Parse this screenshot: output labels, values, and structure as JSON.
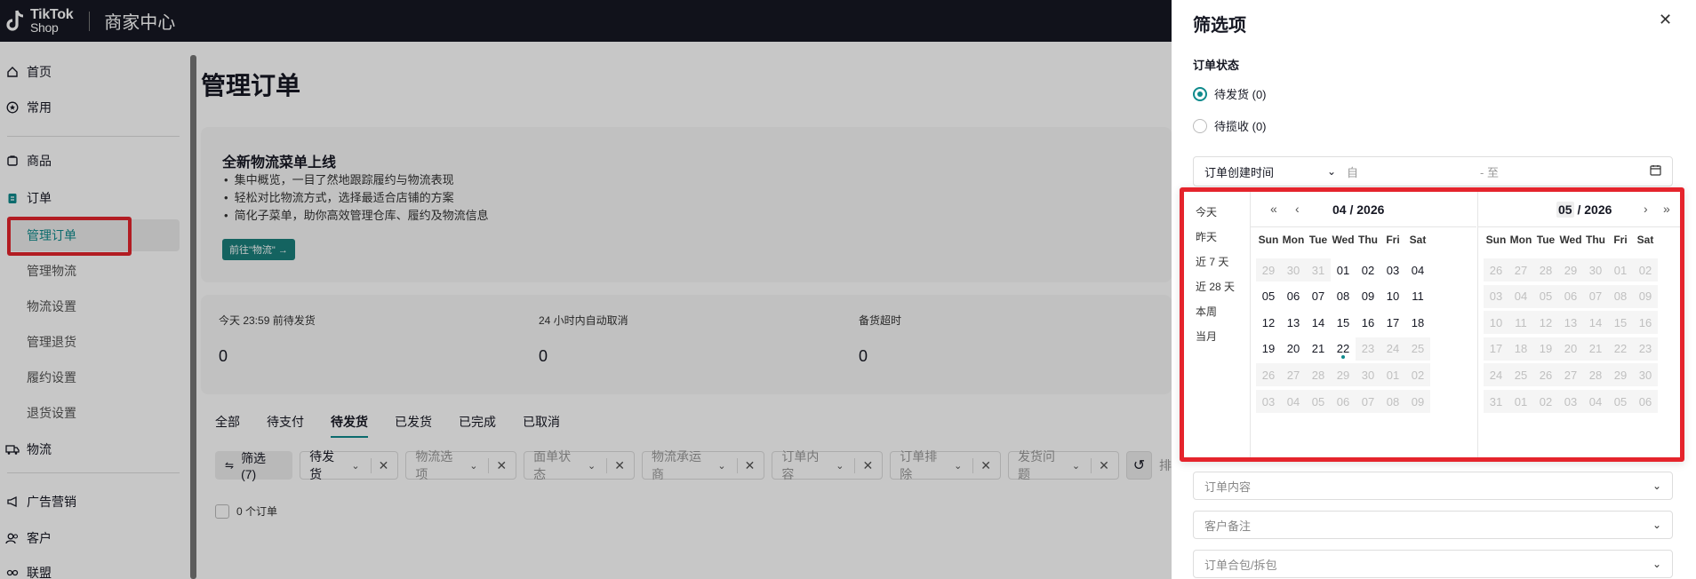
{
  "topbar": {
    "brand_line1": "TikTok",
    "brand_line2": "Shop",
    "title": "商家中心"
  },
  "sidebar": {
    "items": [
      {
        "label": "首页",
        "icon": "home-icon"
      },
      {
        "label": "常用",
        "icon": "star-icon"
      },
      {
        "label": "商品",
        "icon": "product-icon"
      },
      {
        "label": "订单",
        "icon": "order-icon"
      },
      {
        "label": "物流",
        "icon": "truck-icon"
      },
      {
        "label": "广告营销",
        "icon": "megaphone-icon"
      },
      {
        "label": "客户",
        "icon": "users-icon"
      },
      {
        "label": "联盟",
        "icon": "affiliate-icon"
      }
    ],
    "order_subitems": [
      {
        "label": "管理订单",
        "active": true
      },
      {
        "label": "管理物流"
      },
      {
        "label": "物流设置"
      },
      {
        "label": "管理退货"
      },
      {
        "label": "履约设置"
      },
      {
        "label": "退货设置"
      }
    ]
  },
  "main": {
    "title": "管理订单",
    "banner": {
      "heading": "全新物流菜单上线",
      "bullets": [
        "集中概览，一目了然地跟踪履约与物流表现",
        "轻松对比物流方式，选择最适合店铺的方案",
        "简化子菜单，助你高效管理仓库、履约及物流信息"
      ],
      "button": "前往\"物流\" →"
    },
    "stats": [
      {
        "label": "今天 23:59 前待发货",
        "value": "0"
      },
      {
        "label": "24 小时内自动取消",
        "value": "0"
      },
      {
        "label": "备货超时",
        "value": "0"
      }
    ],
    "tabs": [
      "全部",
      "待支付",
      "待发货",
      "已发货",
      "已完成",
      "已取消"
    ],
    "active_tab": "待发货",
    "filter_button": "筛选 (7)",
    "chips": [
      {
        "label": "待发货",
        "muted": false
      },
      {
        "label": "物流选项",
        "muted": true
      },
      {
        "label": "面单状态",
        "muted": true
      },
      {
        "label": "物流承运商",
        "muted": true
      },
      {
        "label": "订单内容",
        "muted": true
      },
      {
        "label": "订单排除",
        "muted": true
      },
      {
        "label": "发货问题",
        "muted": true
      }
    ],
    "trailing_text": "排",
    "order_count": "0 个订单"
  },
  "drawer": {
    "title": "筛选项",
    "status_label": "订单状态",
    "radios": [
      {
        "label": "待发货 (0)",
        "checked": true
      },
      {
        "label": "待揽收 (0)",
        "checked": false
      }
    ],
    "date_type": "订单创建时间",
    "date_from": "自",
    "date_to": "- 至",
    "selects": [
      "订单内容",
      "客户备注",
      "订单合包/拆包"
    ]
  },
  "calendar": {
    "presets": [
      "今天",
      "昨天",
      "近 7 天",
      "近 28 天",
      "本周",
      "当月"
    ],
    "weekdays": [
      "Sun",
      "Mon",
      "Tue",
      "Wed",
      "Thu",
      "Fri",
      "Sat"
    ],
    "months": [
      {
        "label_month": "04",
        "label_year": "2026",
        "weeks": [
          [
            "29",
            "30",
            "31",
            "01",
            "02",
            "03",
            "04"
          ],
          [
            "05",
            "06",
            "07",
            "08",
            "09",
            "10",
            "11"
          ],
          [
            "12",
            "13",
            "14",
            "15",
            "16",
            "17",
            "18"
          ],
          [
            "19",
            "20",
            "21",
            "22",
            "23",
            "24",
            "25"
          ],
          [
            "26",
            "27",
            "28",
            "29",
            "30",
            "01",
            "02"
          ],
          [
            "03",
            "04",
            "05",
            "06",
            "07",
            "08",
            "09"
          ]
        ]
      },
      {
        "label_month": "05",
        "label_year": "2026",
        "weeks": [
          [
            "26",
            "27",
            "28",
            "29",
            "30",
            "01",
            "02"
          ],
          [
            "03",
            "04",
            "05",
            "06",
            "07",
            "08",
            "09"
          ],
          [
            "10",
            "11",
            "12",
            "13",
            "14",
            "15",
            "16"
          ],
          [
            "17",
            "18",
            "19",
            "20",
            "21",
            "22",
            "23"
          ],
          [
            "24",
            "25",
            "26",
            "27",
            "28",
            "29",
            "30"
          ],
          [
            "31",
            "01",
            "02",
            "03",
            "04",
            "05",
            "06"
          ]
        ]
      }
    ],
    "today": "22"
  },
  "colors": {
    "accent": "#0f8a8c",
    "highlight_box": "#e5242c",
    "topbar": "#161823"
  }
}
